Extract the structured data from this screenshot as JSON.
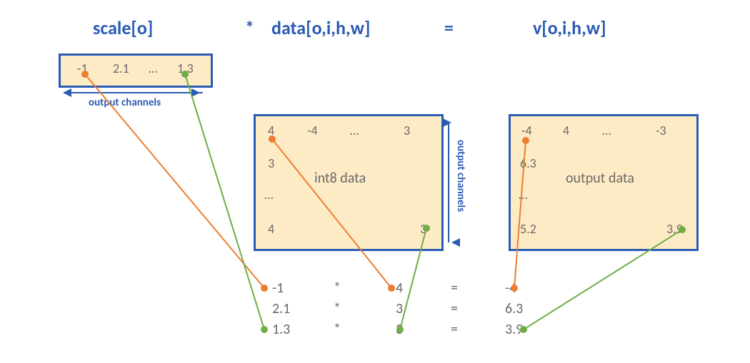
{
  "equation": {
    "lhs": "scale[o]",
    "mul": "*",
    "mid": "data[o,i,h,w]",
    "eq": "=",
    "rhs": "v[o,i,h,w]"
  },
  "scale_vec": {
    "vals": [
      "-1",
      "2.1",
      "…",
      "1.3"
    ],
    "axis": "output channels"
  },
  "data_mat": {
    "row0": [
      "4",
      "-4",
      "…",
      "3"
    ],
    "col0_rest": [
      "3",
      "…",
      "4"
    ],
    "br": "3",
    "label": "int8 data",
    "axis": "output channels"
  },
  "out_mat": {
    "row0": [
      "-4",
      "4",
      "…",
      "-3"
    ],
    "col0_rest": [
      "6.3",
      "…",
      "5.2"
    ],
    "br": "3.9",
    "label": "output data"
  },
  "rows": [
    {
      "a": "-1",
      "b": "4",
      "c": "-4"
    },
    {
      "a": "2.1",
      "b": "3",
      "c": "6.3"
    },
    {
      "a": "1.3",
      "b": "3",
      "c": "3.9"
    }
  ],
  "ops": {
    "mul": "*",
    "eq": "="
  }
}
